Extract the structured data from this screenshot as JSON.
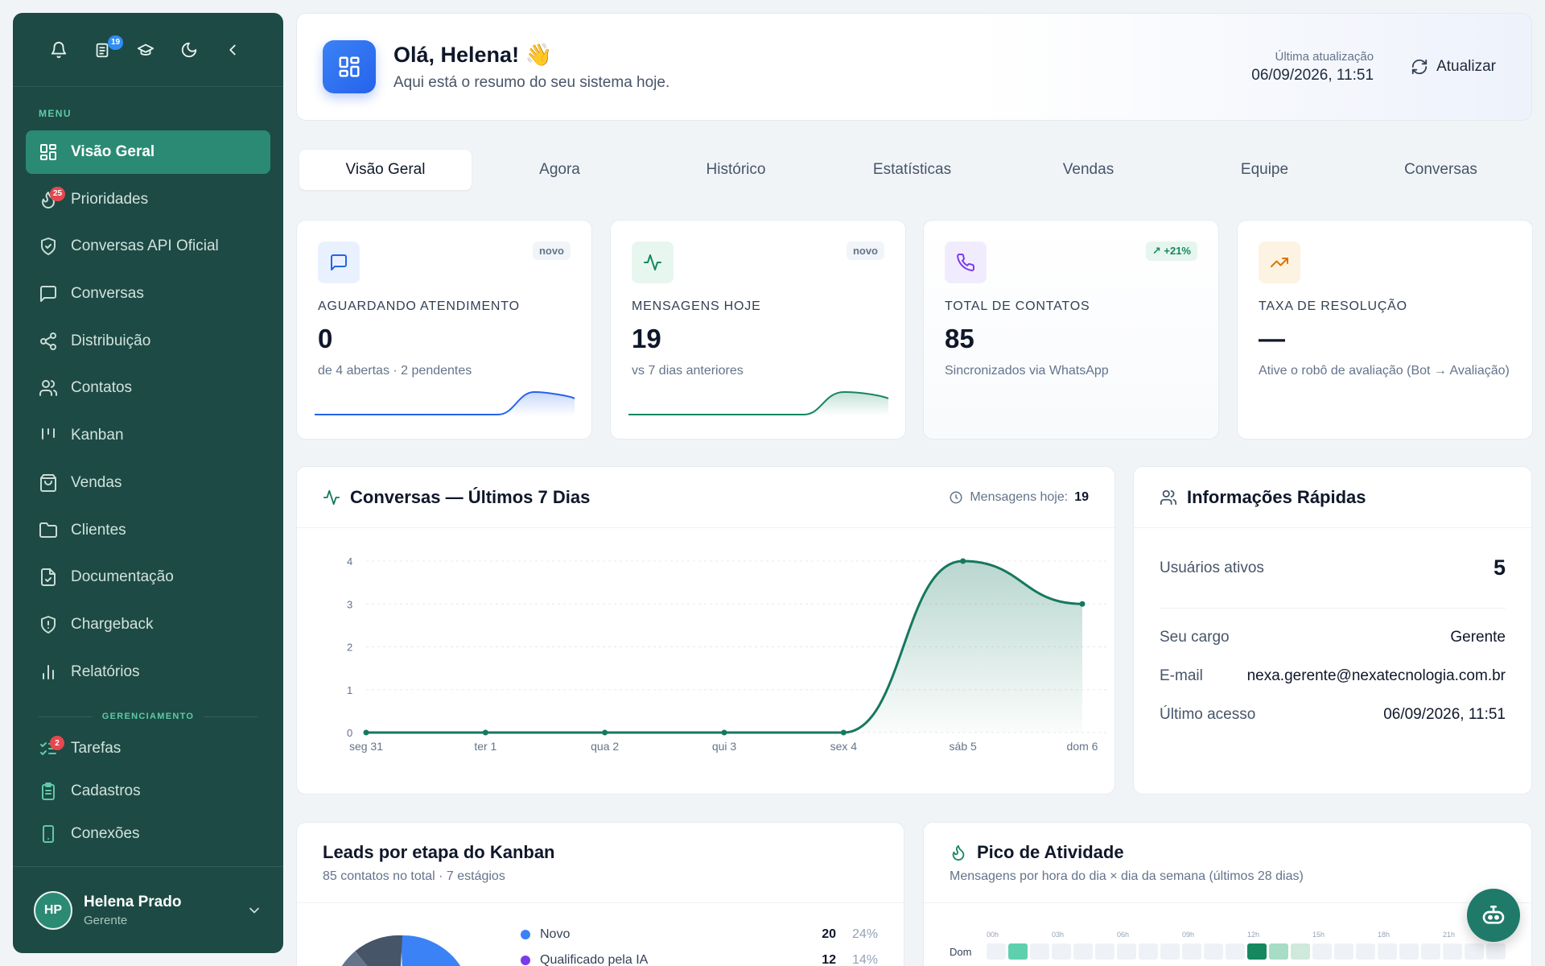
{
  "sidebar": {
    "top_icons": [
      {
        "icon": "bell-icon"
      },
      {
        "icon": "document-icon",
        "badge": "19"
      },
      {
        "icon": "graduation-cap-icon"
      },
      {
        "icon": "moon-icon"
      },
      {
        "icon": "chevron-left-icon"
      }
    ],
    "menu_label": "MENU",
    "items": [
      {
        "label": "Visão Geral",
        "icon": "dashboard-icon",
        "active": true
      },
      {
        "label": "Prioridades",
        "icon": "flame-icon",
        "badge": "25"
      },
      {
        "label": "Conversas API Oficial",
        "icon": "shield-check-icon"
      },
      {
        "label": "Conversas",
        "icon": "chat-icon"
      },
      {
        "label": "Distribuição",
        "icon": "share-icon"
      },
      {
        "label": "Contatos",
        "icon": "users-icon"
      },
      {
        "label": "Kanban",
        "icon": "kanban-icon"
      },
      {
        "label": "Vendas",
        "icon": "shopping-bag-icon"
      },
      {
        "label": "Clientes",
        "icon": "folder-icon"
      },
      {
        "label": "Documentação",
        "icon": "file-check-icon"
      },
      {
        "label": "Chargeback",
        "icon": "shield-alert-icon"
      },
      {
        "label": "Relatórios",
        "icon": "bar-chart-icon"
      }
    ],
    "management_label": "GERENCIAMENTO",
    "management_items": [
      {
        "label": "Tarefas",
        "icon": "checklist-icon",
        "badge": "2"
      },
      {
        "label": "Cadastros",
        "icon": "clipboard-icon"
      },
      {
        "label": "Conexões",
        "icon": "smartphone-icon"
      }
    ],
    "user": {
      "initials": "HP",
      "name": "Helena Prado",
      "role": "Gerente"
    }
  },
  "header": {
    "title": "Olá, Helena! 👋",
    "subtitle": "Aqui está o resumo do seu sistema hoje.",
    "updated_label": "Última atualização",
    "updated_value": "06/09/2026, 11:51",
    "refresh_label": "Atualizar"
  },
  "tabs": [
    "Visão Geral",
    "Agora",
    "Histórico",
    "Estatísticas",
    "Vendas",
    "Equipe",
    "Conversas"
  ],
  "stats": [
    {
      "label": "AGUARDANDO ATENDIMENTO",
      "value": "0",
      "desc": "de 4 abertas · 2 pendentes",
      "tag": "novo",
      "color": "#2563eb"
    },
    {
      "label": "MENSAGENS HOJE",
      "value": "19",
      "desc": "vs 7 dias anteriores",
      "tag": "novo",
      "color": "#16875f"
    },
    {
      "label": "TOTAL DE CONTATOS",
      "value": "85",
      "desc": "Sincronizados via WhatsApp",
      "tag": "+21%",
      "color": "#7c3aed"
    },
    {
      "label": "TAXA DE RESOLUÇÃO",
      "value": "—",
      "desc": "Ative o robô de avaliação (Bot → Avaliação)",
      "color": "#d97706"
    }
  ],
  "chart": {
    "title": "Conversas — Últimos 7 Dias",
    "meta_label": "Mensagens hoje:",
    "meta_value": "19"
  },
  "chart_data": {
    "type": "area",
    "categories": [
      "seg 31",
      "ter 1",
      "qua 2",
      "qui 3",
      "sex 4",
      "sáb 5",
      "dom 6"
    ],
    "values": [
      0,
      0,
      0,
      0,
      0,
      4,
      3
    ],
    "yticks": [
      0,
      1,
      2,
      3,
      4
    ],
    "ylim": [
      0,
      4
    ],
    "color": "#16785f"
  },
  "info": {
    "title": "Informações Rápidas",
    "rows": [
      {
        "k": "Usuários ativos",
        "v": "5"
      },
      {
        "k": "Seu cargo",
        "v": "Gerente"
      },
      {
        "k": "E-mail",
        "v": "nexa.gerente@nexatecnologia.com.br"
      },
      {
        "k": "Último acesso",
        "v": "06/09/2026, 11:51"
      }
    ]
  },
  "leads": {
    "title": "Leads por etapa do Kanban",
    "subtitle": "85 contatos no total · 7 estágios",
    "legend": [
      {
        "label": "Novo",
        "count": "20",
        "pct": "24%",
        "color": "#3b82f6"
      },
      {
        "label": "Qualificado pela IA",
        "count": "12",
        "pct": "14%",
        "color": "#7c3aed"
      }
    ]
  },
  "peak": {
    "title": "Pico de Atividade",
    "subtitle": "Mensagens por hora do dia × dia da semana (últimos 28 dias)",
    "hours": [
      "00h",
      "03h",
      "06h",
      "09h",
      "12h",
      "15h",
      "18h",
      "21h"
    ],
    "day": "Dom"
  }
}
